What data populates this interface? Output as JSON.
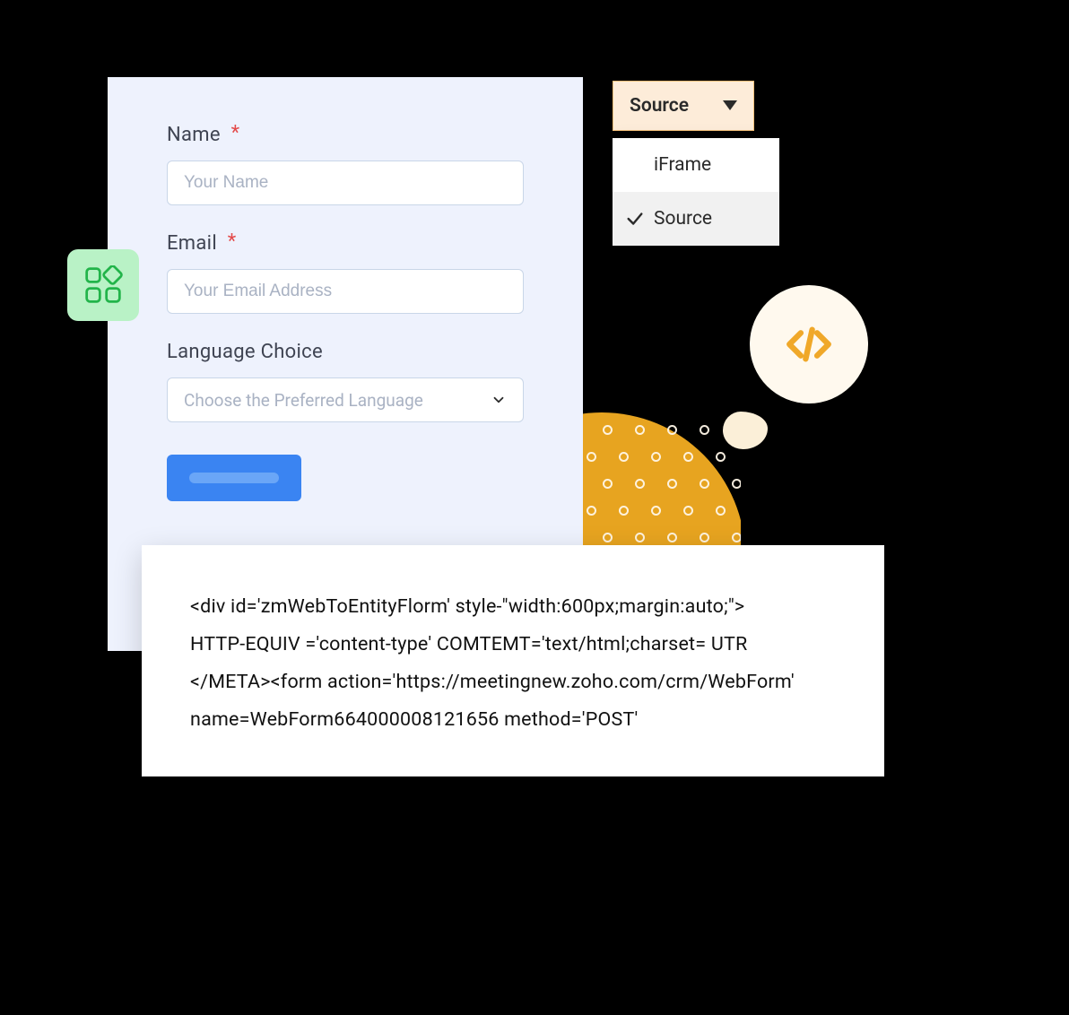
{
  "form": {
    "name": {
      "label": "Name",
      "placeholder": "Your Name",
      "required": true
    },
    "email": {
      "label": "Email",
      "placeholder": "Your Email Address",
      "required": true
    },
    "language": {
      "label": "Language Choice",
      "placeholder": "Choose the Preferred Language"
    }
  },
  "source_dropdown": {
    "label": "Source",
    "options": [
      "iFrame",
      "Source"
    ],
    "selected": "Source"
  },
  "code_snippet": {
    "line1": "<div id='zmWebToEntityFlorm' style-\"width:600px;margin:auto;\">",
    "line2": "HTTP-EQUIV ='content-type' COMTEMT='text/html;charset= UTR",
    "line3": "</META><form action='https://meetingnew.zoho.com/crm/WebForm'",
    "line4": "name=WebForm664000008121656 method='POST'"
  },
  "icons": {
    "apps": "apps-icon",
    "code": "code-icon",
    "chevron_down": "chevron-down-icon",
    "caret_down": "caret-down-icon",
    "check": "check-icon"
  }
}
